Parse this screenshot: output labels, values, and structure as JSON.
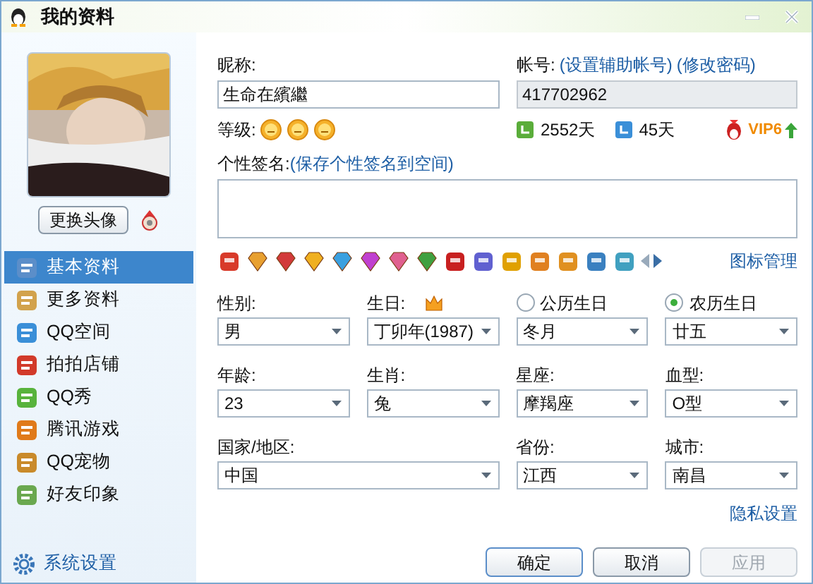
{
  "window": {
    "title": "我的资料"
  },
  "sidebar": {
    "change_avatar_button": "更换头像",
    "items": [
      {
        "label": "基本资料",
        "selected": true
      },
      {
        "label": "更多资料",
        "selected": false
      },
      {
        "label": "QQ空间",
        "selected": false
      },
      {
        "label": "拍拍店铺",
        "selected": false
      },
      {
        "label": "QQ秀",
        "selected": false
      },
      {
        "label": "腾讯游戏",
        "selected": false
      },
      {
        "label": "QQ宠物",
        "selected": false
      },
      {
        "label": "好友印象",
        "selected": false
      }
    ],
    "settings_link": "系统设置"
  },
  "profile": {
    "nickname_label": "昵称:",
    "nickname": "生命在繽繼",
    "account_label": "帐号:",
    "account_links": [
      "(设置辅助帐号)",
      "(修改密码)"
    ],
    "account": "417702962",
    "level_label": "等级:",
    "active_days": "2552天",
    "online_days": "45天",
    "vip": "VIP6",
    "signature_label": "个性签名:",
    "signature_link": "(保存个性签名到空间)",
    "icon_manage_link": "图标管理"
  },
  "fields": [
    {
      "kind": "select",
      "label": "性别:",
      "value": "男"
    },
    {
      "kind": "select",
      "label": "生日:",
      "value": "丁卯年(1987)",
      "crown": true
    },
    {
      "kind": "radio-select",
      "label": "公历生日",
      "selected": false,
      "value": "冬月"
    },
    {
      "kind": "radio-select",
      "label": "农历生日",
      "selected": true,
      "value": "廿五"
    },
    {
      "kind": "select",
      "label": "年龄:",
      "value": "23"
    },
    {
      "kind": "select",
      "label": "生肖:",
      "value": "兔"
    },
    {
      "kind": "select",
      "label": "星座:",
      "value": "摩羯座"
    },
    {
      "kind": "select",
      "label": "血型:",
      "value": "O型"
    },
    {
      "kind": "wide-select",
      "label": "国家/地区:",
      "value": "中国"
    },
    {
      "kind": "select",
      "label": "省份:",
      "value": "江西"
    },
    {
      "kind": "select",
      "label": "城市:",
      "value": "南昌"
    }
  ],
  "privacy_link": "隐私设置",
  "buttons": [
    {
      "label": "确定",
      "disabled": false
    },
    {
      "label": "取消",
      "disabled": false
    },
    {
      "label": "应用",
      "disabled": true
    }
  ]
}
